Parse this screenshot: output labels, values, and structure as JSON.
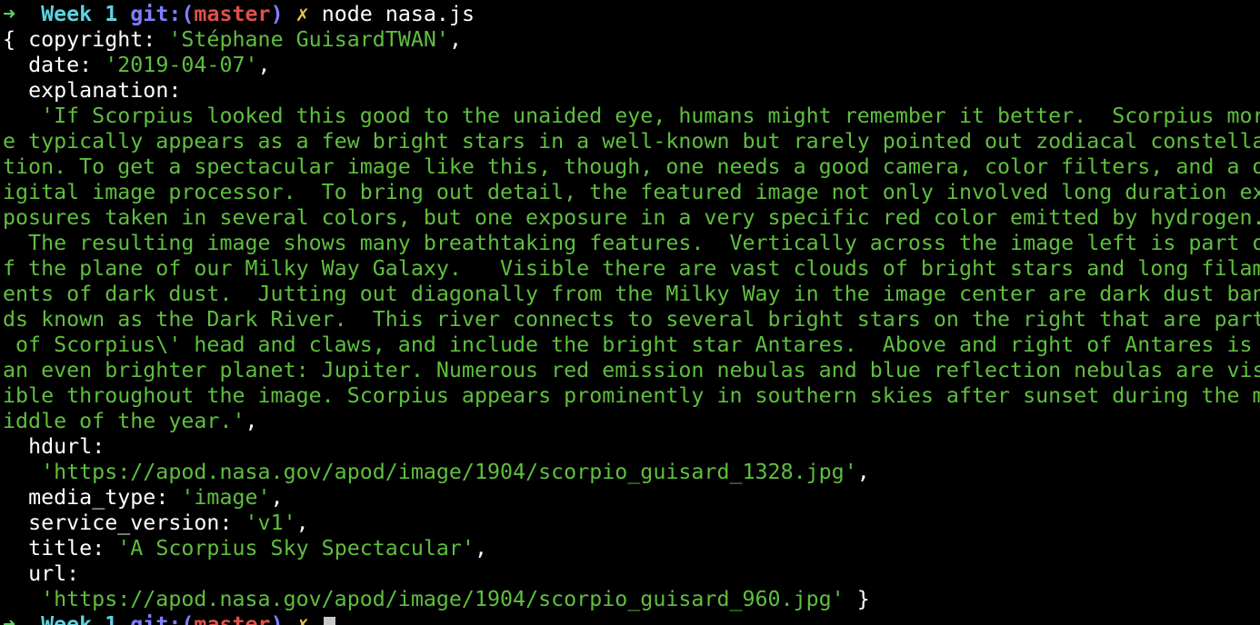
{
  "prompt": {
    "arrow": "➜",
    "cwd": "Week 1",
    "git_prefix": "git:(",
    "branch": "master",
    "git_suffix": ")",
    "dirty": "✗",
    "command": "node nasa.js"
  },
  "output": {
    "open_brace": "{ ",
    "copyright_key": "copyright: ",
    "copyright_value": "'Stéphane GuisardTWAN'",
    "date_key": "date: ",
    "date_value": "'2019-04-07'",
    "explanation_key": "explanation:",
    "explanation_lines": [
      "'If Scorpius looked this good to the unaided eye, humans might remember it better.  Scorpius mor",
      "e typically appears as a few bright stars in a well-known but rarely pointed out zodiacal constella",
      "tion. To get a spectacular image like this, though, one needs a good camera, color filters, and a d",
      "igital image processor.  To bring out detail, the featured image not only involved long duration ex",
      "posures taken in several colors, but one exposure in a very specific red color emitted by hydrogen.",
      "  The resulting image shows many breathtaking features.  Vertically across the image left is part o",
      "f the plane of our Milky Way Galaxy.   Visible there are vast clouds of bright stars and long filam",
      "ents of dark dust.  Jutting out diagonally from the Milky Way in the image center are dark dust ban",
      "ds known as the Dark River.  This river connects to several bright stars on the right that are part",
      " of Scorpius\\' head and claws, and include the bright star Antares.  Above and right of Antares is",
      "an even brighter planet: Jupiter. Numerous red emission nebulas and blue reflection nebulas are vis",
      "ible throughout the image. Scorpius appears prominently in southern skies after sunset during the m",
      "iddle of the year.'"
    ],
    "hdurl_key": "hdurl:",
    "hdurl_value": "'https://apod.nasa.gov/apod/image/1904/scorpio_guisard_1328.jpg'",
    "media_type_key": "media_type: ",
    "media_type_value": "'image'",
    "service_version_key": "service_version: ",
    "service_version_value": "'v1'",
    "title_key": "title: ",
    "title_value": "'A Scorpius Sky Spectacular'",
    "url_key": "url:",
    "url_value": "'https://apod.nasa.gov/apod/image/1904/scorpio_guisard_960.jpg'",
    "close_brace": " }"
  },
  "colors": {
    "background": "#000000",
    "prompt_arrow": "#5fd35f",
    "cwd": "#5fd3e0",
    "git": "#7f7fff",
    "branch": "#e0504a",
    "dirty": "#e6c84a",
    "string": "#5fbf3f"
  }
}
